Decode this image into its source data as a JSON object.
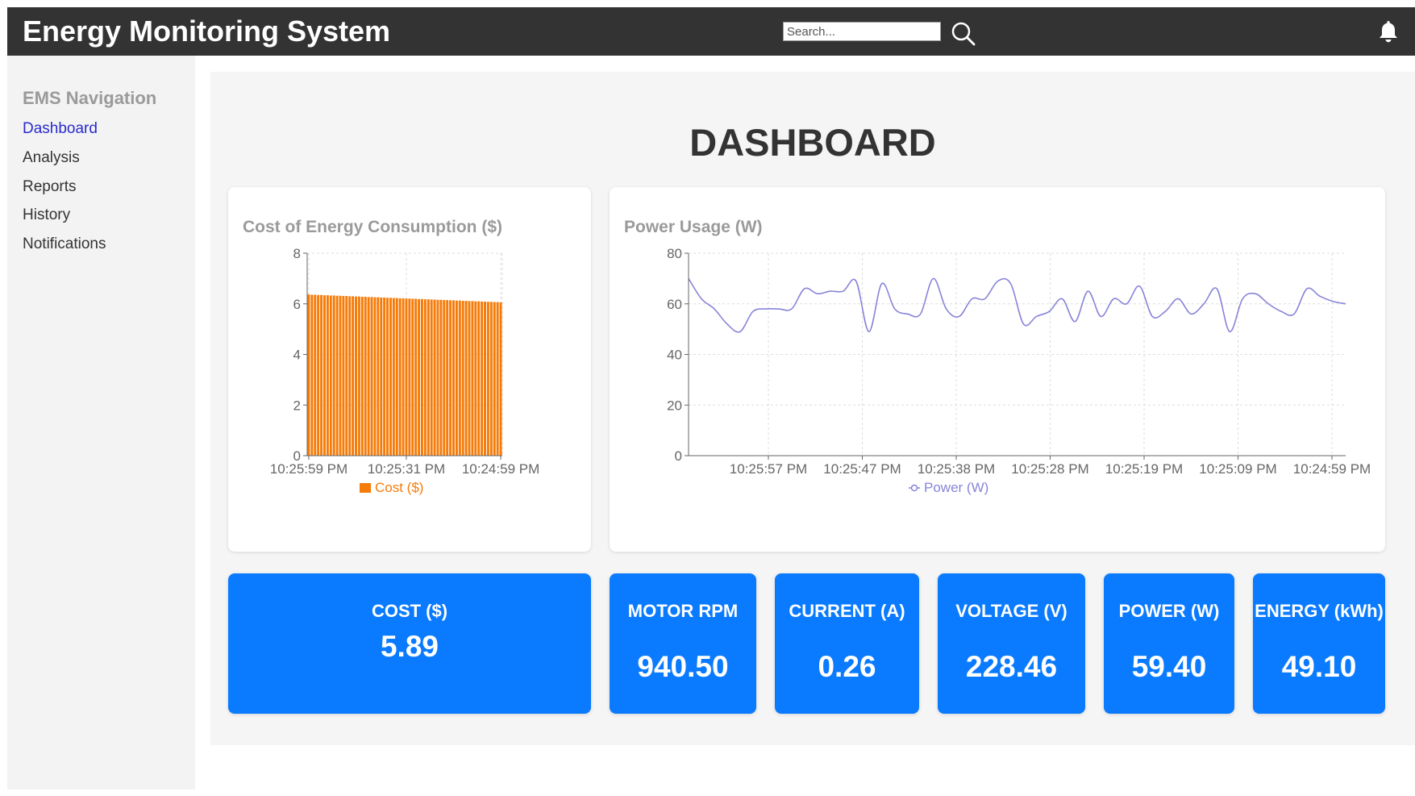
{
  "header": {
    "title": "Energy Monitoring System",
    "search_placeholder": "Search...",
    "search_icon": "search-icon",
    "bell_icon": "bell-icon"
  },
  "sidebar": {
    "title": "EMS Navigation",
    "items": [
      {
        "label": "Dashboard",
        "active": true
      },
      {
        "label": "Analysis",
        "active": false
      },
      {
        "label": "Reports",
        "active": false
      },
      {
        "label": "History",
        "active": false
      },
      {
        "label": "Notifications",
        "active": false
      }
    ]
  },
  "main": {
    "title": "DASHBOARD"
  },
  "colors": {
    "topbar": "#333333",
    "sidebar_bg": "#f3f3f3",
    "accent_blue": "#0a7bff",
    "bar_orange": "#f57c0a",
    "line_purple": "#8884d8",
    "active_nav": "#2a2acf"
  },
  "metrics": [
    {
      "label": "COST ($)",
      "value": "5.89"
    },
    {
      "label": "MOTOR RPM",
      "value": "940.50"
    },
    {
      "label": "CURRENT (A)",
      "value": "0.26"
    },
    {
      "label": "VOLTAGE (V)",
      "value": "228.46"
    },
    {
      "label": "POWER (W)",
      "value": "59.40"
    },
    {
      "label": "ENERGY (kWh)",
      "value": "49.10"
    }
  ],
  "chart_data": [
    {
      "type": "bar",
      "title": "Cost of Energy Consumption ($)",
      "legend": [
        "Cost ($)"
      ],
      "legend_position": "bottom",
      "ylim": [
        0,
        8
      ],
      "y_ticks": [
        0,
        2,
        4,
        6,
        8
      ],
      "x_tick_labels": [
        "10:25:59 PM",
        "10:25:31 PM",
        "10:24:59 PM"
      ],
      "grid": true,
      "series": [
        {
          "name": "Cost ($)",
          "values": [
            6.37,
            6.36,
            6.36,
            6.35,
            6.35,
            6.34,
            6.34,
            6.33,
            6.33,
            6.32,
            6.32,
            6.31,
            6.31,
            6.3,
            6.3,
            6.29,
            6.29,
            6.28,
            6.28,
            6.27,
            6.27,
            6.26,
            6.26,
            6.25,
            6.25,
            6.24,
            6.24,
            6.23,
            6.23,
            6.22,
            6.22,
            6.21,
            6.21,
            6.2,
            6.2,
            6.19,
            6.19,
            6.18,
            6.18,
            6.17,
            6.17,
            6.16,
            6.16,
            6.15,
            6.15,
            6.14,
            6.14,
            6.13,
            6.13,
            6.12,
            6.12,
            6.11,
            6.11,
            6.1,
            6.1,
            6.09,
            6.09,
            6.08,
            6.08,
            6.07,
            6.07,
            6.06
          ]
        }
      ]
    },
    {
      "type": "line",
      "title": "Power Usage (W)",
      "legend": [
        "Power (W)"
      ],
      "legend_position": "bottom",
      "ylim": [
        0,
        80
      ],
      "y_ticks": [
        0,
        20,
        40,
        60,
        80
      ],
      "x_tick_labels": [
        "10:25:57 PM",
        "10:25:47 PM",
        "10:25:38 PM",
        "10:25:28 PM",
        "10:25:19 PM",
        "10:25:09 PM",
        "10:24:59 PM"
      ],
      "grid": true,
      "series": [
        {
          "name": "Power (W)",
          "values": [
            70,
            62,
            58,
            52,
            49,
            57,
            58,
            58,
            58,
            66,
            64,
            65,
            65,
            69,
            49,
            68,
            58,
            56,
            56,
            70,
            58,
            55,
            62,
            62,
            69,
            68,
            52,
            55,
            57,
            62,
            53,
            65,
            55,
            62,
            60,
            67,
            55,
            57,
            62,
            56,
            60,
            66,
            49,
            62,
            64,
            60,
            57,
            56,
            66,
            63,
            61,
            60
          ]
        }
      ]
    }
  ]
}
